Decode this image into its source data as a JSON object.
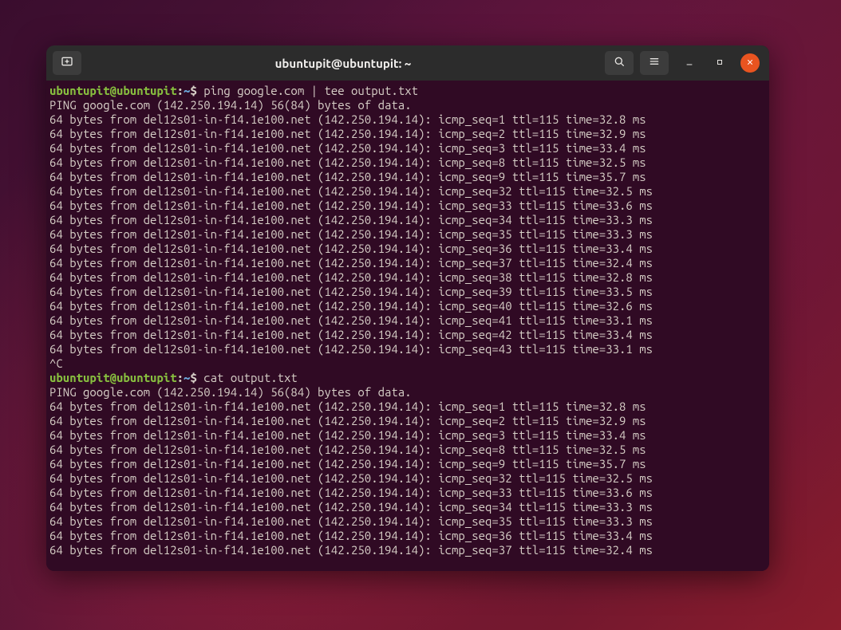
{
  "window": {
    "title": "ubuntupit@ubuntupit: ~"
  },
  "prompt": {
    "user_host": "ubuntupit@ubuntupit",
    "sep1": ":",
    "path": "~",
    "sep2": "$ "
  },
  "icons": {
    "new_tab": "new-tab-icon",
    "search": "search-icon",
    "menu": "menu-icon",
    "minimize": "minimize-icon",
    "maximize": "maximize-icon",
    "close": "close-icon"
  },
  "session": [
    {
      "type": "cmd",
      "text": "ping google.com | tee output.txt"
    },
    {
      "type": "out",
      "text": "PING google.com (142.250.194.14) 56(84) bytes of data."
    },
    {
      "type": "out",
      "text": "64 bytes from del12s01-in-f14.1e100.net (142.250.194.14): icmp_seq=1 ttl=115 time=32.8 ms"
    },
    {
      "type": "out",
      "text": "64 bytes from del12s01-in-f14.1e100.net (142.250.194.14): icmp_seq=2 ttl=115 time=32.9 ms"
    },
    {
      "type": "out",
      "text": "64 bytes from del12s01-in-f14.1e100.net (142.250.194.14): icmp_seq=3 ttl=115 time=33.4 ms"
    },
    {
      "type": "out",
      "text": "64 bytes from del12s01-in-f14.1e100.net (142.250.194.14): icmp_seq=8 ttl=115 time=32.5 ms"
    },
    {
      "type": "out",
      "text": "64 bytes from del12s01-in-f14.1e100.net (142.250.194.14): icmp_seq=9 ttl=115 time=35.7 ms"
    },
    {
      "type": "out",
      "text": "64 bytes from del12s01-in-f14.1e100.net (142.250.194.14): icmp_seq=32 ttl=115 time=32.5 ms"
    },
    {
      "type": "out",
      "text": "64 bytes from del12s01-in-f14.1e100.net (142.250.194.14): icmp_seq=33 ttl=115 time=33.6 ms"
    },
    {
      "type": "out",
      "text": "64 bytes from del12s01-in-f14.1e100.net (142.250.194.14): icmp_seq=34 ttl=115 time=33.3 ms"
    },
    {
      "type": "out",
      "text": "64 bytes from del12s01-in-f14.1e100.net (142.250.194.14): icmp_seq=35 ttl=115 time=33.3 ms"
    },
    {
      "type": "out",
      "text": "64 bytes from del12s01-in-f14.1e100.net (142.250.194.14): icmp_seq=36 ttl=115 time=33.4 ms"
    },
    {
      "type": "out",
      "text": "64 bytes from del12s01-in-f14.1e100.net (142.250.194.14): icmp_seq=37 ttl=115 time=32.4 ms"
    },
    {
      "type": "out",
      "text": "64 bytes from del12s01-in-f14.1e100.net (142.250.194.14): icmp_seq=38 ttl=115 time=32.8 ms"
    },
    {
      "type": "out",
      "text": "64 bytes from del12s01-in-f14.1e100.net (142.250.194.14): icmp_seq=39 ttl=115 time=33.5 ms"
    },
    {
      "type": "out",
      "text": "64 bytes from del12s01-in-f14.1e100.net (142.250.194.14): icmp_seq=40 ttl=115 time=32.6 ms"
    },
    {
      "type": "out",
      "text": "64 bytes from del12s01-in-f14.1e100.net (142.250.194.14): icmp_seq=41 ttl=115 time=33.1 ms"
    },
    {
      "type": "out",
      "text": "64 bytes from del12s01-in-f14.1e100.net (142.250.194.14): icmp_seq=42 ttl=115 time=33.4 ms"
    },
    {
      "type": "out",
      "text": "64 bytes from del12s01-in-f14.1e100.net (142.250.194.14): icmp_seq=43 ttl=115 time=33.1 ms"
    },
    {
      "type": "out",
      "text": "^C"
    },
    {
      "type": "cmd",
      "text": "cat output.txt"
    },
    {
      "type": "out",
      "text": "PING google.com (142.250.194.14) 56(84) bytes of data."
    },
    {
      "type": "out",
      "text": "64 bytes from del12s01-in-f14.1e100.net (142.250.194.14): icmp_seq=1 ttl=115 time=32.8 ms"
    },
    {
      "type": "out",
      "text": "64 bytes from del12s01-in-f14.1e100.net (142.250.194.14): icmp_seq=2 ttl=115 time=32.9 ms"
    },
    {
      "type": "out",
      "text": "64 bytes from del12s01-in-f14.1e100.net (142.250.194.14): icmp_seq=3 ttl=115 time=33.4 ms"
    },
    {
      "type": "out",
      "text": "64 bytes from del12s01-in-f14.1e100.net (142.250.194.14): icmp_seq=8 ttl=115 time=32.5 ms"
    },
    {
      "type": "out",
      "text": "64 bytes from del12s01-in-f14.1e100.net (142.250.194.14): icmp_seq=9 ttl=115 time=35.7 ms"
    },
    {
      "type": "out",
      "text": "64 bytes from del12s01-in-f14.1e100.net (142.250.194.14): icmp_seq=32 ttl=115 time=32.5 ms"
    },
    {
      "type": "out",
      "text": "64 bytes from del12s01-in-f14.1e100.net (142.250.194.14): icmp_seq=33 ttl=115 time=33.6 ms"
    },
    {
      "type": "out",
      "text": "64 bytes from del12s01-in-f14.1e100.net (142.250.194.14): icmp_seq=34 ttl=115 time=33.3 ms"
    },
    {
      "type": "out",
      "text": "64 bytes from del12s01-in-f14.1e100.net (142.250.194.14): icmp_seq=35 ttl=115 time=33.3 ms"
    },
    {
      "type": "out",
      "text": "64 bytes from del12s01-in-f14.1e100.net (142.250.194.14): icmp_seq=36 ttl=115 time=33.4 ms"
    },
    {
      "type": "out",
      "text": "64 bytes from del12s01-in-f14.1e100.net (142.250.194.14): icmp_seq=37 ttl=115 time=32.4 ms"
    }
  ]
}
